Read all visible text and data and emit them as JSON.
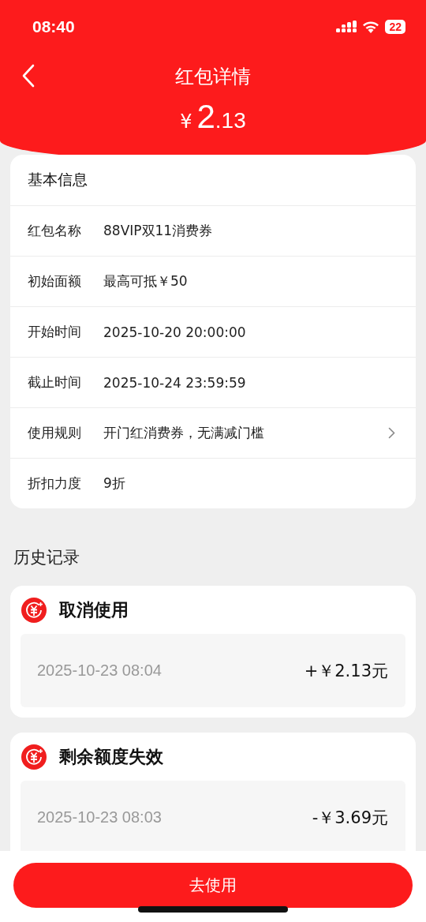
{
  "status_bar": {
    "time": "08:40",
    "battery": "22"
  },
  "header": {
    "title": "红包详情",
    "amount": {
      "currency": "¥",
      "integer": "2",
      "decimal": ".13"
    }
  },
  "info_card": {
    "title": "基本信息",
    "rows": [
      {
        "label": "红包名称",
        "value": "88VIP双11消费券",
        "has_arrow": false
      },
      {
        "label": "初始面额",
        "value": "最高可抵￥50",
        "has_arrow": false
      },
      {
        "label": "开始时间",
        "value": "2025-10-20 20:00:00",
        "has_arrow": false
      },
      {
        "label": "截止时间",
        "value": "2025-10-24 23:59:59",
        "has_arrow": false
      },
      {
        "label": "使用规则",
        "value": "开门红消费券，无满减门槛",
        "has_arrow": true
      },
      {
        "label": "折扣力度",
        "value": "9折",
        "has_arrow": false
      }
    ]
  },
  "history": {
    "title": "历史记录",
    "entries": [
      {
        "title": "取消使用",
        "time": "2025-10-23 08:04",
        "amount": "+￥2.13元"
      },
      {
        "title": "剩余额度失效",
        "time": "2025-10-23 08:03",
        "amount": "-￥3.69元"
      }
    ]
  },
  "action_button": "去使用"
}
